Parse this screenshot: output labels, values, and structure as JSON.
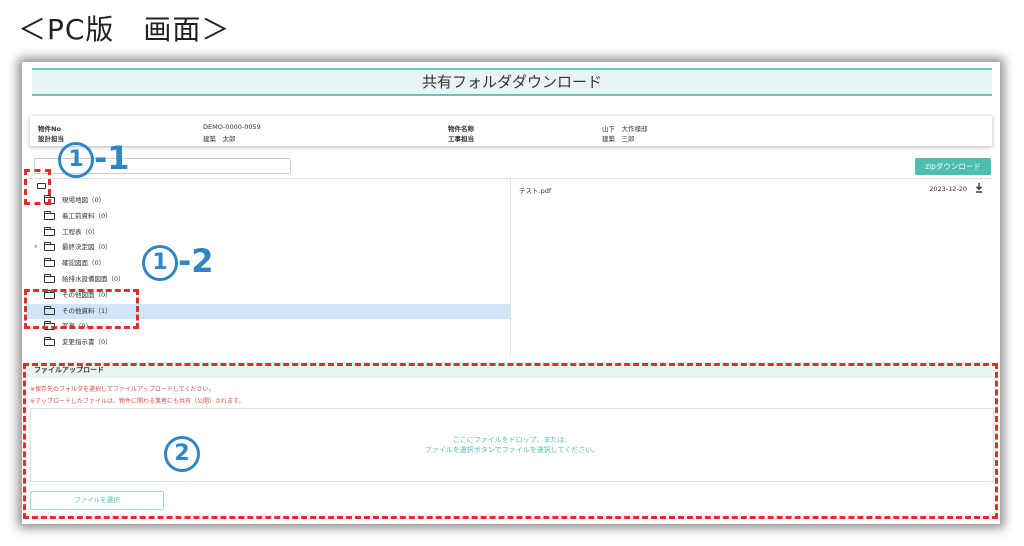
{
  "caption": "＜PC版　画面＞",
  "app": {
    "title": "共有フォルダダウンロード"
  },
  "info": {
    "property_no_label": "物件No",
    "property_no_value": "DEMO-0000-0059",
    "designer_label": "設計担当",
    "designer_value": "建築　太郎",
    "property_name_label": "物件名称",
    "property_name_value": "山下　大作様邸",
    "construction_label": "工事担当",
    "construction_value": "建築　三郎"
  },
  "toolbar": {
    "zip_button": "zipダウンロード",
    "search_placeholder": ""
  },
  "tree": {
    "items": [
      {
        "label": "現場地図（0）",
        "expandable": false,
        "selected": false
      },
      {
        "label": "着工前資料（0）",
        "expandable": false,
        "selected": false
      },
      {
        "label": "工程表（0）",
        "expandable": false,
        "selected": false
      },
      {
        "label": "最終決定図（0）",
        "expandable": true,
        "selected": false
      },
      {
        "label": "確認図面（0）",
        "expandable": false,
        "selected": false
      },
      {
        "label": "給排水設備図面（0）",
        "expandable": false,
        "selected": false
      },
      {
        "label": "その他図面（0）",
        "expandable": false,
        "selected": false
      },
      {
        "label": "その他資料（1）",
        "expandable": false,
        "selected": true
      },
      {
        "label": "写真（0）",
        "expandable": false,
        "selected": false
      },
      {
        "label": "変更指示書（0）",
        "expandable": false,
        "selected": false
      }
    ]
  },
  "files": [
    {
      "name": "テスト.pdf",
      "date": "2023-12-20"
    }
  ],
  "upload": {
    "header": "ファイルアップロード",
    "note1": "※保存先のフォルダを選択してファイルアップロードしてください。",
    "note2": "※アップロードしたファイルは、物件に関わる業者にも共有（公開）されます。",
    "drop_line1": "ここにファイルをドロップ、または、",
    "drop_line2": "ファイルを選択ボタンでファイルを選択してください。",
    "select_button": "ファイルを選択"
  },
  "annotations": {
    "a1_num": "1",
    "a1_suffix": "-1",
    "a2_num": "1",
    "a2_suffix": "-2",
    "a3_num": "2"
  },
  "colors": {
    "accent": "#4dbfae",
    "annotation": "#2e86c8",
    "highlight": "#e52b2b",
    "selected_row": "#cfe5f8"
  }
}
